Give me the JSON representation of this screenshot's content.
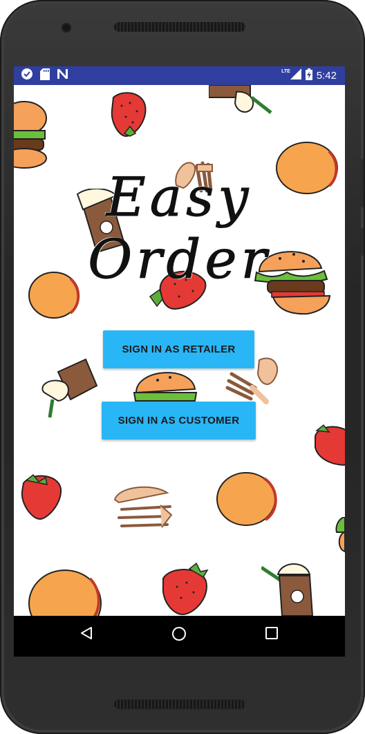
{
  "status_bar": {
    "icons": [
      "heart-check-icon",
      "sd-card-icon",
      "n-logo-icon",
      "lte-signal-icon",
      "battery-charging-icon"
    ],
    "network_label": "LTE",
    "time": "5:42"
  },
  "app": {
    "title": "Easy Order",
    "retailer_button_label": "SIGN IN AS RETAILER",
    "customer_button_label": "SIGN IN AS CUSTOMER",
    "background_icons": [
      "burger-icon",
      "strawberry-icon",
      "drink-icon",
      "cookie-icon",
      "cutlery-icon"
    ]
  },
  "nav_bar": {
    "icons": [
      "back-icon",
      "home-icon",
      "recents-icon"
    ]
  },
  "colors": {
    "status_bar": "#303f9f",
    "button": "#29b6f6",
    "button_text": "#1a1a1a",
    "nav_bar": "#000000"
  }
}
